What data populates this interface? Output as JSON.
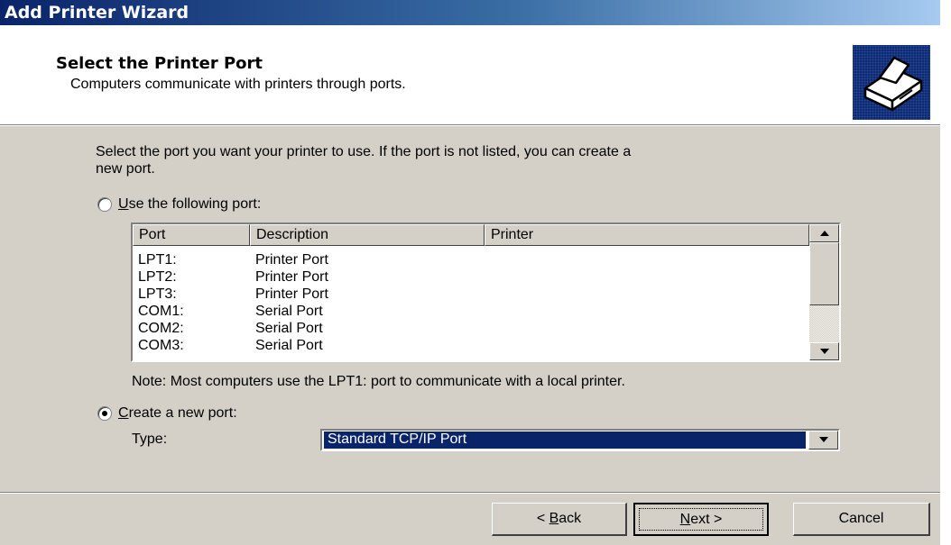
{
  "window": {
    "title": "Add Printer Wizard"
  },
  "header": {
    "title": "Select the Printer Port",
    "subtitle": "Computers communicate with printers through ports.",
    "icon": "printer-icon"
  },
  "instructions": {
    "line1": "Select the port you want your printer to use.  If the port is not listed, you can create a",
    "line2": "new port."
  },
  "use_port": {
    "label_u": "U",
    "label_rest": "se the following port:",
    "selected": false
  },
  "port_list": {
    "columns": [
      "Port",
      "Description",
      "Printer"
    ],
    "rows": [
      {
        "port": "LPT1:",
        "description": "Printer Port",
        "printer": ""
      },
      {
        "port": "LPT2:",
        "description": "Printer Port",
        "printer": ""
      },
      {
        "port": "LPT3:",
        "description": "Printer Port",
        "printer": ""
      },
      {
        "port": "COM1:",
        "description": "Serial Port",
        "printer": ""
      },
      {
        "port": "COM2:",
        "description": "Serial Port",
        "printer": ""
      },
      {
        "port": "COM3:",
        "description": "Serial Port",
        "printer": ""
      }
    ]
  },
  "note": "Note: Most computers use the LPT1: port to communicate with a local printer.",
  "create_port": {
    "label_u": "C",
    "label_rest": "reate a new port:",
    "selected": true,
    "type_label": "Type:",
    "type_value": "Standard TCP/IP Port"
  },
  "buttons": {
    "back_prefix": "< ",
    "back_u": "B",
    "back_rest": "ack",
    "next_u": "N",
    "next_rest": "ext >",
    "cancel": "Cancel"
  },
  "colors": {
    "titlebar_start": "#0a246a",
    "titlebar_end": "#a6caf0",
    "dialog_bg": "#d4d0c8",
    "selection": "#0a246a"
  }
}
